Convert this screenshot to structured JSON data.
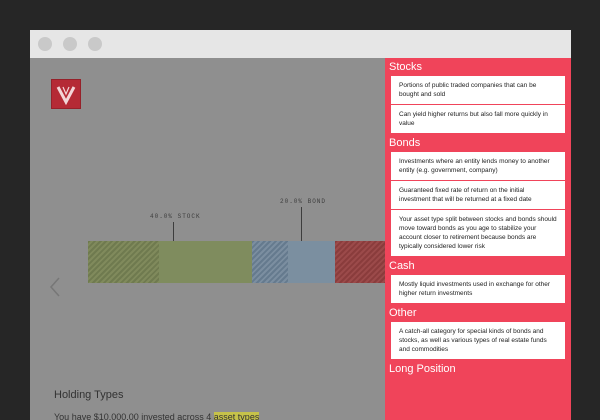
{
  "colors": {
    "panel": "#f0445a",
    "logo": "#b52a35",
    "stock": "#7f8c5e",
    "bond": "#7b8fa0",
    "cash": "#9b4a4a"
  },
  "logo": {
    "letter": "V"
  },
  "chart": {
    "labels": [
      {
        "text": "40.0% STOCK"
      },
      {
        "text": "20.0% BOND"
      }
    ]
  },
  "chart_data": {
    "type": "bar",
    "categories": [
      "STOCK",
      "BOND",
      "CASH"
    ],
    "values": [
      40.0,
      20.0,
      13.0
    ]
  },
  "holding": {
    "title": "Holding Types",
    "desc_prefix": "You have $10,000.00 invested across 4 ",
    "desc_highlight": "asset types"
  },
  "sections": [
    {
      "title": "Stocks",
      "items": [
        "Portions of public traded companies that can be bought and sold",
        "Can yield higher returns but also fall more quickly in value"
      ]
    },
    {
      "title": "Bonds",
      "items": [
        "Investments where an entity lends money to another entity (e.g. government, company)",
        "Guaranteed fixed rate of return on the initial investment that will be returned at a fixed date",
        "Your asset type split between stocks and bonds should move toward bonds as you age to stabilize your account closer to retirement because bonds are typically considered lower risk"
      ]
    },
    {
      "title": "Cash",
      "items": [
        "Mostly liquid investments used in exchange for other higher return investments"
      ]
    },
    {
      "title": "Other",
      "items": [
        "A catch-all category for special kinds of bonds and stocks, as well as various types of real estate funds and commodities"
      ]
    },
    {
      "title": "Long Position",
      "items": []
    }
  ]
}
